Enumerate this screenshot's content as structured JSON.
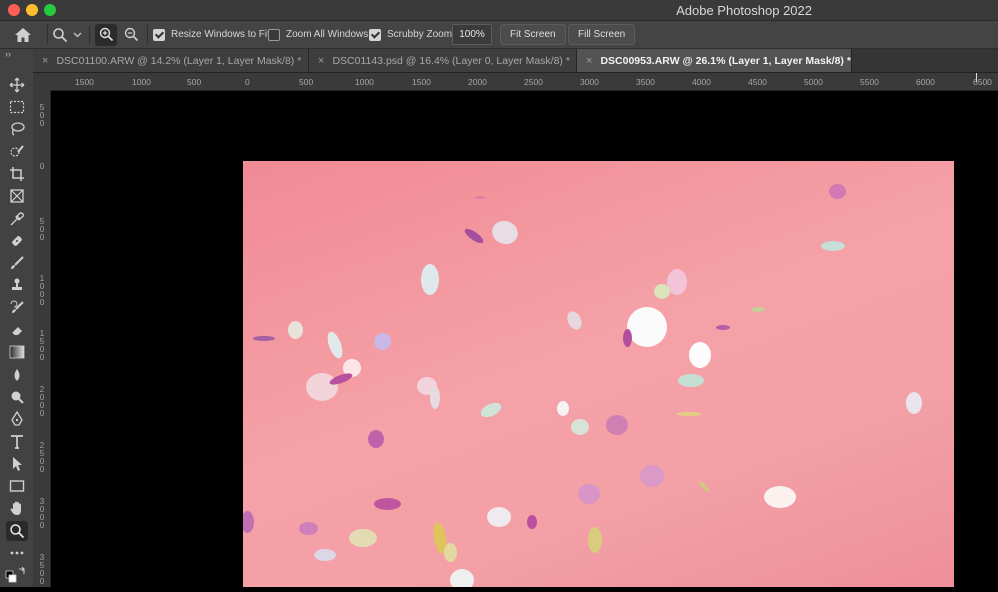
{
  "window": {
    "title": "Adobe Photoshop 2022"
  },
  "options_bar": {
    "resize_windows_label": "Resize Windows to Fit",
    "zoom_all_label": "Zoom All Windows",
    "scrubby_zoom_label": "Scrubby Zoom",
    "zoom_value": "100%",
    "fit_screen_label": "Fit Screen",
    "fill_screen_label": "Fill Screen",
    "resize_windows_checked": true,
    "zoom_all_checked": false,
    "scrubby_zoom_checked": true
  },
  "tabs": [
    {
      "label": "DSC01100.ARW @ 14.2% (Layer 1, Layer Mask/8) *",
      "close": "×",
      "active": false
    },
    {
      "label": "DSC01143.psd @ 16.4% (Layer 0, Layer Mask/8) *",
      "close": "×",
      "active": false
    },
    {
      "label": "DSC00953.ARW @ 26.1% (Layer 1, Layer Mask/8) *",
      "close": "×",
      "active": true
    }
  ],
  "tabbar_expand": "››",
  "ruler_h": [
    "1500",
    "1000",
    "500",
    "0",
    "500",
    "1000",
    "1500",
    "2000",
    "2500",
    "3000",
    "3500",
    "4000",
    "4500",
    "5000",
    "5500",
    "6000",
    "6500"
  ],
  "ruler_v": [
    "500",
    "0",
    "500",
    "1000",
    "1500",
    "2000",
    "2500",
    "3000",
    "3500"
  ],
  "tools": [
    "move-icon",
    "marquee-icon",
    "lasso-icon",
    "quick-select-icon",
    "crop-icon",
    "frame-icon",
    "eyedropper-icon",
    "healing-brush-icon",
    "brush-icon",
    "stamp-icon",
    "history-brush-icon",
    "eraser-icon",
    "gradient-icon",
    "blur-icon",
    "dodge-icon",
    "pen-icon",
    "type-icon",
    "path-select-icon",
    "rectangle-icon",
    "hand-icon",
    "zoom-icon",
    "more-tools-icon"
  ],
  "colors": {
    "canvas_pink": "#f39aa2",
    "ui_dark": "#424242"
  }
}
